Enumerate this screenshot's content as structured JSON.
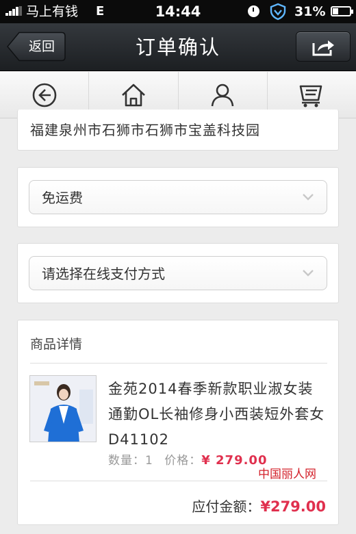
{
  "status_bar": {
    "carrier": "马上有钱",
    "network": "E",
    "time": "14:44",
    "battery": "31%"
  },
  "header": {
    "back_label": "返回",
    "title": "订单确认",
    "share_icon": "share-icon"
  },
  "nav": {
    "items": [
      {
        "icon": "back-circle-icon"
      },
      {
        "icon": "home-icon"
      },
      {
        "icon": "user-icon"
      },
      {
        "icon": "cart-icon"
      }
    ]
  },
  "address": {
    "text": "福建泉州市石狮市石狮市宝盖科技园"
  },
  "shipping": {
    "selected": "免运费"
  },
  "payment": {
    "selected": "请选择在线支付方式"
  },
  "details": {
    "title": "商品详情",
    "product": {
      "name": "金苑2014春季新款职业淑女装通勤OL长袖修身小西装短外套女D41102",
      "quantity_label": "数量：",
      "quantity": "1",
      "price_label": "价格：",
      "price": "¥ 279.00"
    },
    "total_label": "应付金额：",
    "total": "¥279.00"
  },
  "watermark": "中国丽人网",
  "colors": {
    "accent_price": "#e0304e",
    "header_bg": "#24282c",
    "page_bg": "#ececec"
  }
}
